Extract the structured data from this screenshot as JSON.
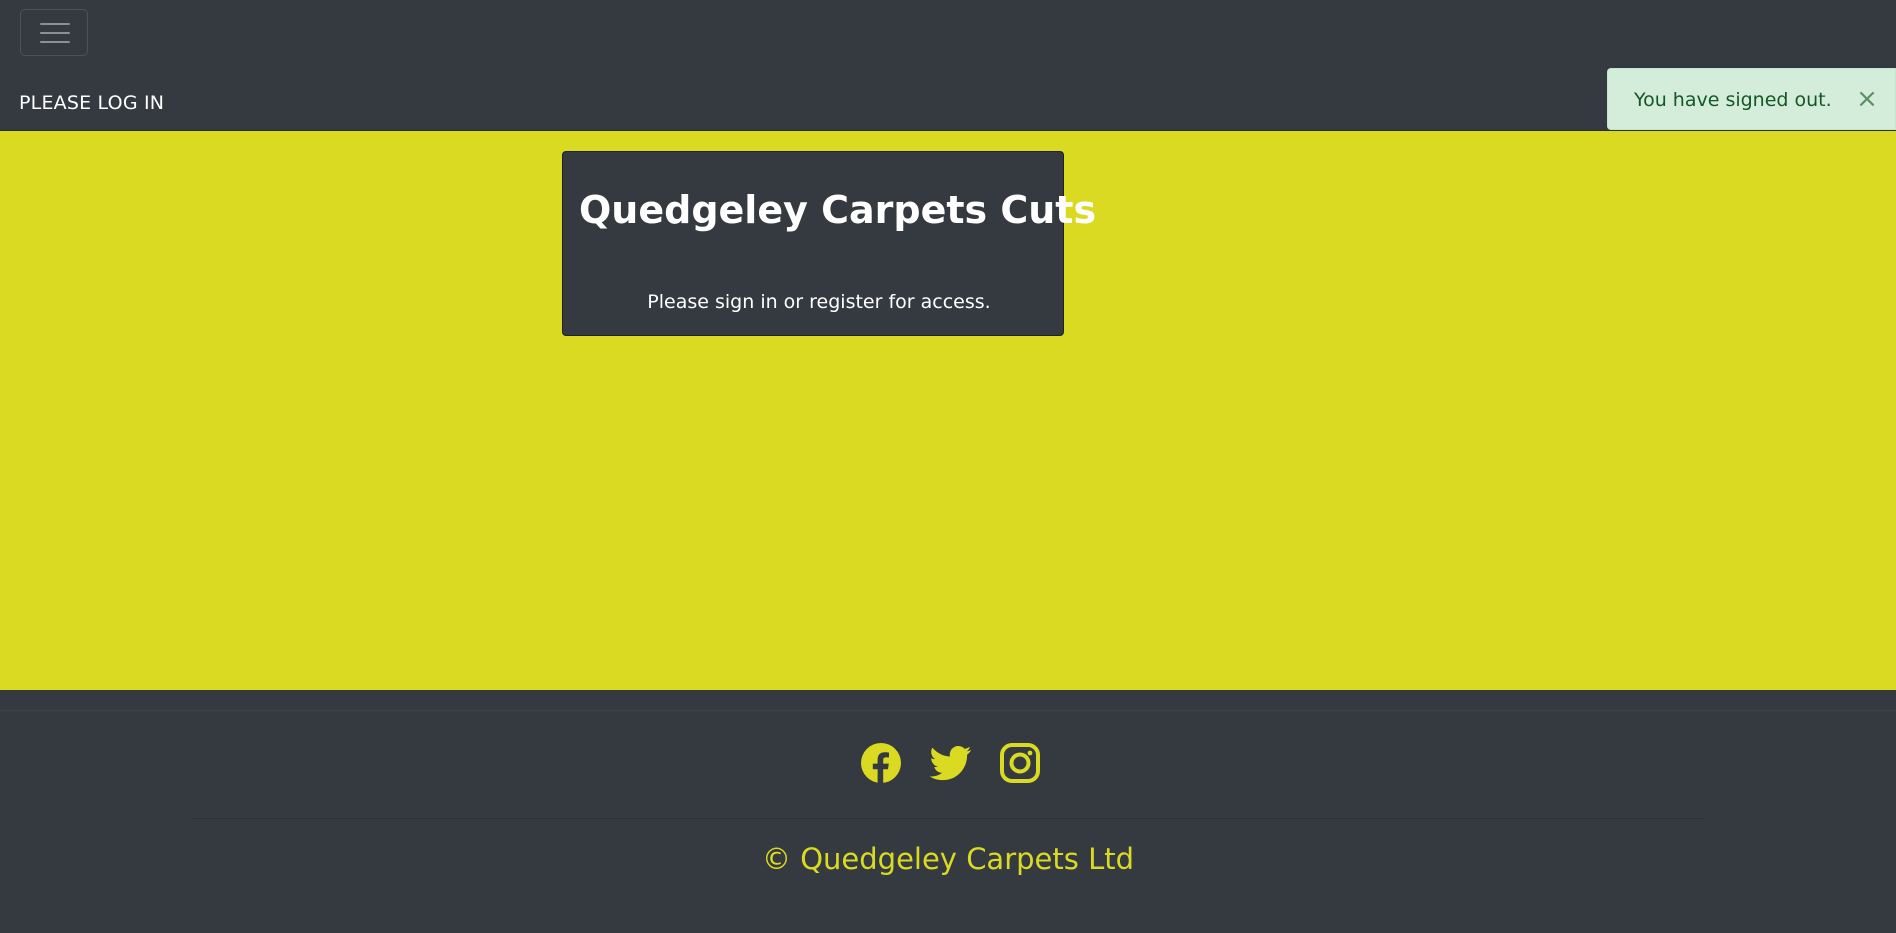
{
  "navbar": {
    "toggler_icon": "hamburger-menu-icon",
    "login_label": "PLEASE LOG IN"
  },
  "alert": {
    "message": "You have signed out.",
    "close_symbol": "×"
  },
  "card": {
    "title": "Quedgeley Carpets Cuts",
    "text": "Please sign in or register for access."
  },
  "footer": {
    "social_icons": [
      "facebook-icon",
      "twitter-icon",
      "instagram-icon"
    ],
    "copyright": "© Quedgeley Carpets Ltd"
  },
  "colors": {
    "dark": "#343a40",
    "accent_yellow": "#dada22",
    "alert_bg": "#d4edda",
    "alert_text": "#155724"
  }
}
